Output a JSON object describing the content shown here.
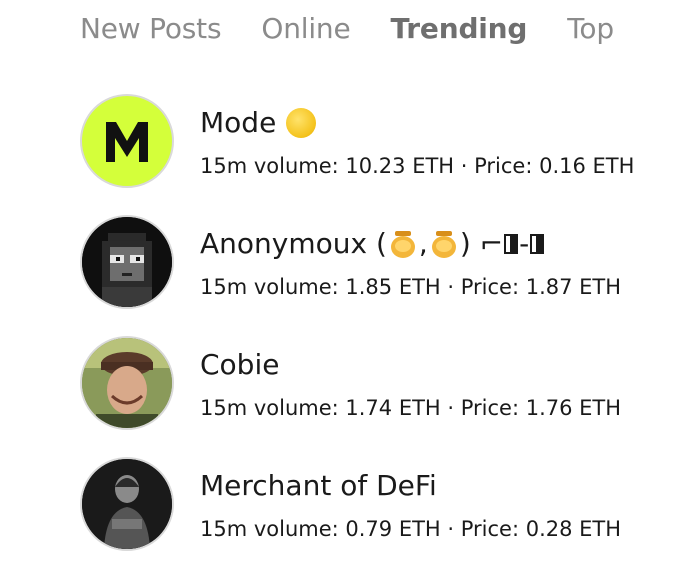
{
  "tabs": [
    {
      "label": "New Posts",
      "active": false
    },
    {
      "label": "Online",
      "active": false
    },
    {
      "label": "Trending",
      "active": true
    },
    {
      "label": "Top",
      "active": false
    }
  ],
  "users": [
    {
      "name": "Mode",
      "stats": "15m volume: 10.23 ETH · Price: 0.16 ETH",
      "avatar_icon": "mode-logo-icon",
      "name_icon": "yellow-coin-icon",
      "colors": {
        "avatar_bg": "#d4ff3a"
      }
    },
    {
      "name": "Anonymoux (",
      "name_mid": ", ",
      "name_tail": ") ⌐",
      "name_dash": "-",
      "stats": "15m volume: 1.85 ETH · Price: 1.87 ETH",
      "avatar_icon": "pixel-punk-icon"
    },
    {
      "name": "Cobie",
      "stats": "15m volume: 1.74 ETH · Price: 1.76 ETH",
      "avatar_icon": "person-photo-icon"
    },
    {
      "name": "Merchant of DeFi",
      "stats": "15m volume: 0.79 ETH · Price: 0.28 ETH",
      "avatar_icon": "person-bw-photo-icon"
    }
  ]
}
